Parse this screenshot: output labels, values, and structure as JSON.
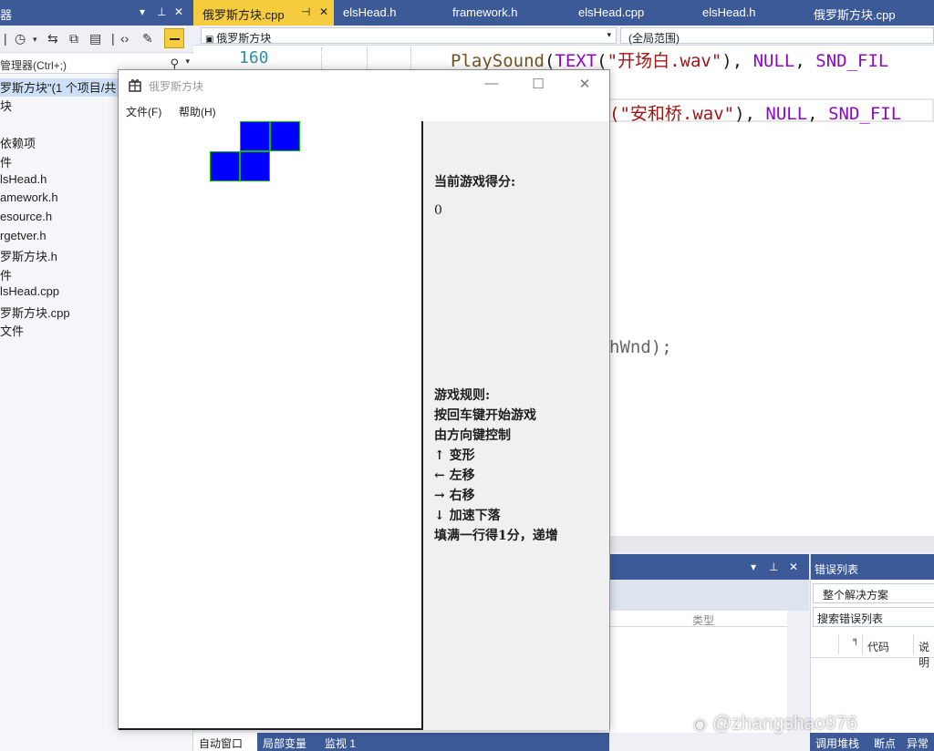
{
  "solution_explorer": {
    "title": "器",
    "search_placeholder": "管理器(Ctrl+;)",
    "solution_label": "罗斯方块\"(1 个项目/共",
    "items": [
      "块",
      "",
      "依赖项",
      "件",
      "lsHead.h",
      "amework.h",
      "esource.h",
      "rgetver.h",
      "罗斯方块.h",
      "件",
      "lsHead.cpp",
      "罗斯方块.cpp",
      "文件"
    ]
  },
  "doc_tabs": [
    {
      "label": "俄罗斯方块.cpp",
      "active": true
    },
    {
      "label": "elsHead.h"
    },
    {
      "label": "framework.h"
    },
    {
      "label": "elsHead.cpp"
    },
    {
      "label": "elsHead.h"
    },
    {
      "label": "俄罗斯方块.cpp"
    }
  ],
  "nav_bar": {
    "project": "俄罗斯方块",
    "scope": "(全局范围)"
  },
  "editor": {
    "line_number": "160",
    "line1": {
      "fn": "PlaySound",
      "p1": "(",
      "mac": "TEXT",
      "p2": "(",
      "str": "\"开场白.wav\"",
      "p3": "), ",
      "null": "NULL",
      "p4": ", ",
      "flag": "SND_FIL"
    },
    "line2": {
      "str": "(\"安和桥.wav\"",
      "p3": "), ",
      "null": "NULL",
      "p4": ", ",
      "flag": "SND_FIL"
    },
    "line3": {
      "text": "hWnd);"
    }
  },
  "game_window": {
    "title": "俄罗斯方块",
    "menu": [
      "文件(F)",
      "帮助(H)"
    ],
    "score_label": "当前游戏得分:",
    "score": "0",
    "rules": [
      "游戏规则:",
      "按回车键开始游戏",
      "由方向键控制",
      "↑ 变形",
      "← 左移",
      "→ 右移",
      "↓ 加速下落",
      "填满一行得1分，递增"
    ],
    "piece_color": "#0000ff",
    "piece_border_color": "#00c000"
  },
  "output_panel": {
    "column_type": "类型"
  },
  "error_list": {
    "title": "错误列表",
    "scope": "整个解决方案",
    "search": "搜索错误列表",
    "col_code": "代码",
    "col_desc": "说明"
  },
  "bottom_tabs_left": [
    "自动窗口",
    "局部变量",
    "监视 1"
  ],
  "bottom_tabs_right": [
    "调用堆栈",
    "断点",
    "异常"
  ],
  "watermark": "@zhangshao976",
  "colors": {
    "titlebar": "#3c5a98",
    "active_tab": "#f5cc3e"
  }
}
